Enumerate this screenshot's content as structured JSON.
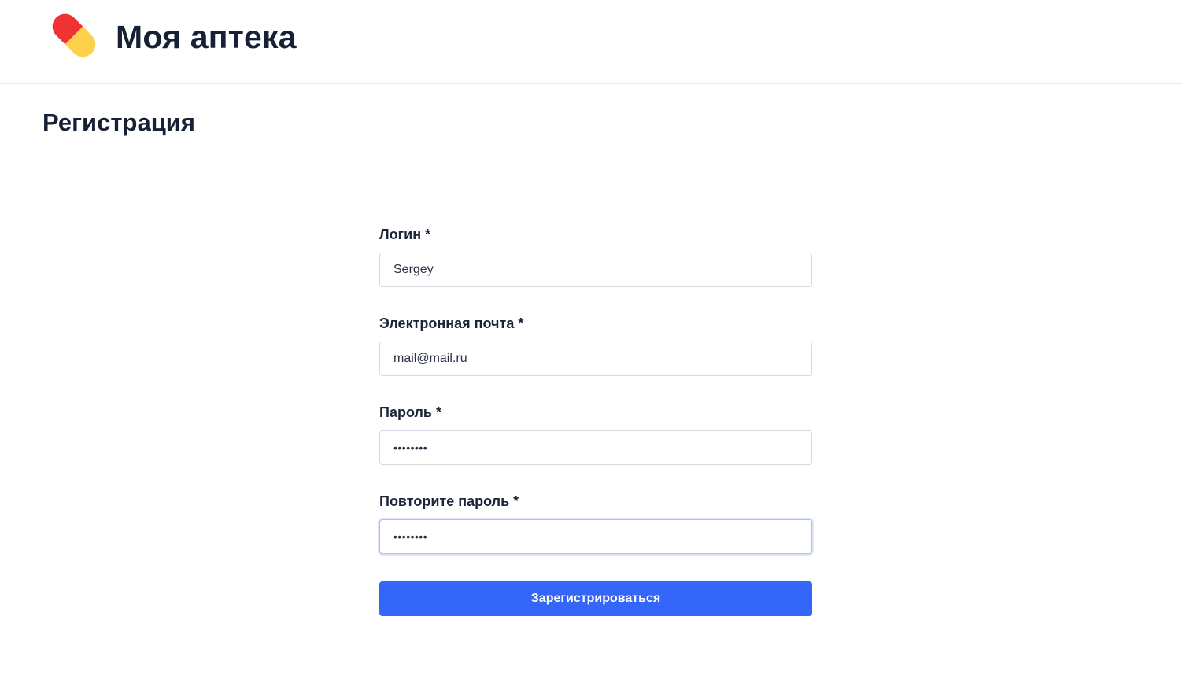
{
  "header": {
    "logo_icon": "pill-icon",
    "logo_colors": {
      "top": "#f03232",
      "bottom": "#fdd24a",
      "highlight": "#ffffff"
    },
    "app_title": "Моя аптека"
  },
  "page": {
    "title": "Регистрация"
  },
  "form": {
    "login": {
      "label": "Логин *",
      "value": "Sergey"
    },
    "email": {
      "label": "Электронная почта *",
      "value": "mail@mail.ru"
    },
    "password": {
      "label": "Пароль *",
      "value": "••••••••"
    },
    "password_repeat": {
      "label": "Повторите пароль *",
      "value": "••••••••",
      "focused": true
    },
    "submit_label": "Зарегистрироваться"
  },
  "colors": {
    "accent": "#3566fa",
    "text": "#172136",
    "border": "#d6d9de",
    "focus_border": "#a9c1f7"
  }
}
